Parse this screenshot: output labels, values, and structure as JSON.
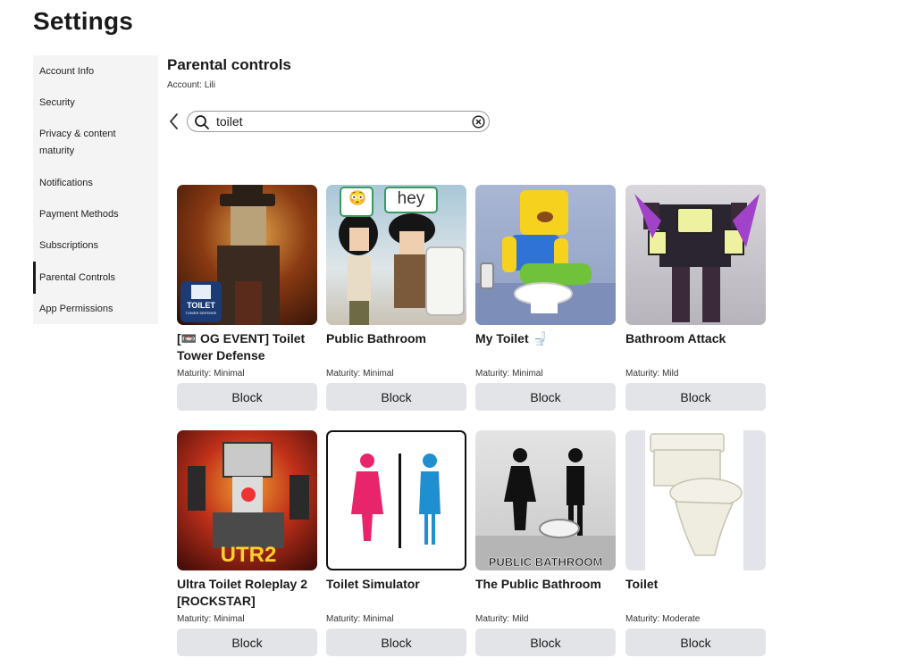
{
  "page": {
    "title": "Settings"
  },
  "sidebar": {
    "items": [
      {
        "label": "Account Info"
      },
      {
        "label": "Security"
      },
      {
        "label": "Privacy & content maturity"
      },
      {
        "label": "Notifications"
      },
      {
        "label": "Payment Methods"
      },
      {
        "label": "Subscriptions"
      },
      {
        "label": "Parental Controls",
        "active": true
      },
      {
        "label": "App Permissions"
      }
    ]
  },
  "main": {
    "section_title": "Parental controls",
    "account_line": "Account: Lili",
    "search": {
      "value": "toilet",
      "icon": "search-icon",
      "clear_icon": "clear-icon",
      "back_icon": "chevron-left-icon"
    },
    "games": [
      {
        "title": "[📼 OG EVENT] Toilet Tower Defense",
        "maturity": "Maturity: Minimal",
        "button": "Block",
        "thumb_badge": "TOILET",
        "thumb_sub": "TOWER DEFENSE"
      },
      {
        "title": "Public Bathroom",
        "maturity": "Maturity: Minimal",
        "button": "Block",
        "thumb_emoji": "😳",
        "thumb_bubble": "hey"
      },
      {
        "title": "My Toilet 🚽",
        "maturity": "Maturity: Minimal",
        "button": "Block"
      },
      {
        "title": "Bathroom Attack",
        "maturity": "Maturity: Mild",
        "button": "Block"
      },
      {
        "title": "Ultra Toilet Roleplay 2 [ROCKSTAR]",
        "maturity": "Maturity: Minimal",
        "button": "Block",
        "thumb_badge": "UTR2"
      },
      {
        "title": "Toilet Simulator",
        "maturity": "Maturity: Minimal",
        "button": "Block"
      },
      {
        "title": "The Public Bathroom",
        "maturity": "Maturity: Mild",
        "button": "Block",
        "thumb_badge": "PUBLIC BATHROOM"
      },
      {
        "title": "Toilet",
        "maturity": "Maturity: Moderate",
        "button": "Block"
      }
    ]
  }
}
